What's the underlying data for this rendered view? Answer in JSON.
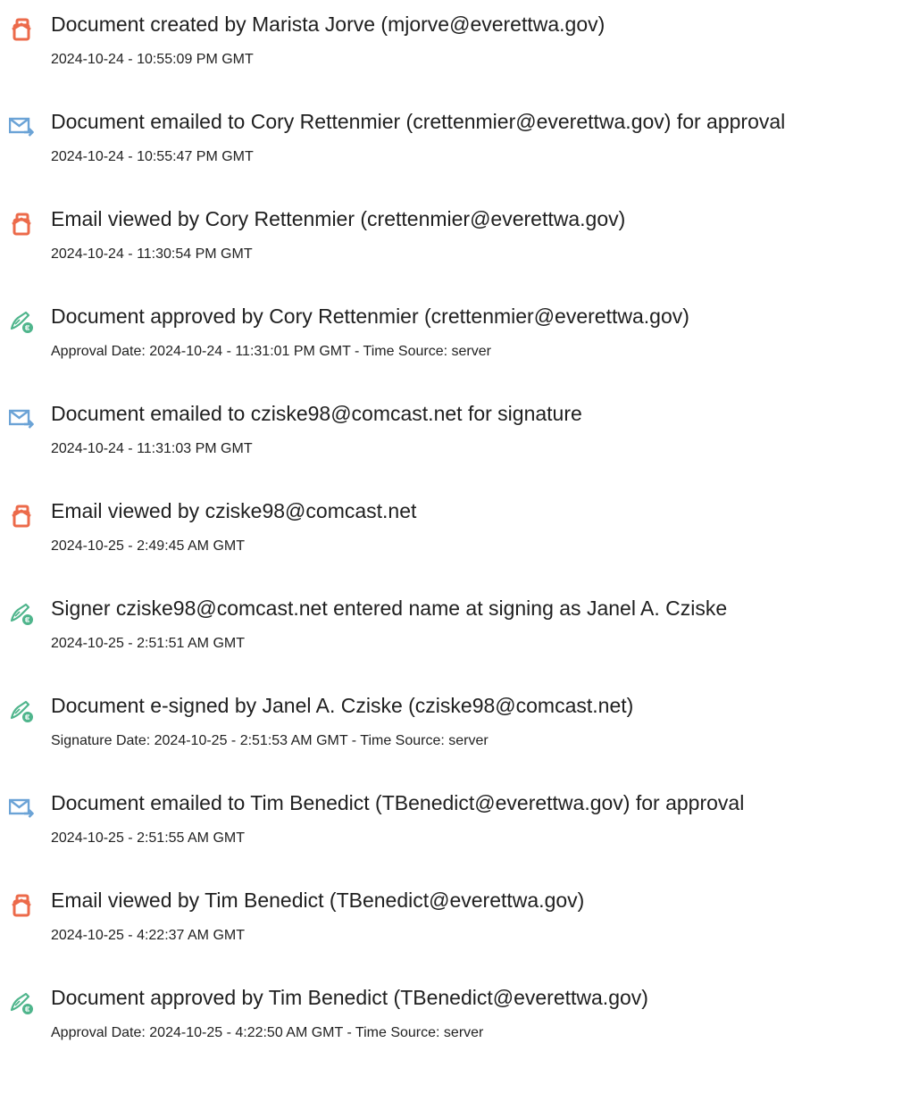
{
  "colors": {
    "icon_doc": "#ec6a4a",
    "icon_email": "#6ba3d6",
    "icon_sign": "#4fb58c"
  },
  "events": [
    {
      "icon": "document-created-icon",
      "title": "Document created by Marista Jorve (mjorve@everettwa.gov)",
      "time": "2024-10-24 - 10:55:09 PM GMT"
    },
    {
      "icon": "email-sent-icon",
      "title": "Document emailed to Cory Rettenmier (crettenmier@everettwa.gov) for approval",
      "time": "2024-10-24 - 10:55:47 PM GMT"
    },
    {
      "icon": "document-viewed-icon",
      "title": "Email viewed by Cory Rettenmier (crettenmier@everettwa.gov)",
      "time": "2024-10-24 - 11:30:54 PM GMT"
    },
    {
      "icon": "pen-signature-icon",
      "title": "Document approved by Cory Rettenmier (crettenmier@everettwa.gov)",
      "time": "Approval Date: 2024-10-24 - 11:31:01 PM GMT - Time Source: server"
    },
    {
      "icon": "email-sent-icon",
      "title": "Document emailed to cziske98@comcast.net for signature",
      "time": "2024-10-24 - 11:31:03 PM GMT"
    },
    {
      "icon": "document-viewed-icon",
      "title": "Email viewed by cziske98@comcast.net",
      "time": "2024-10-25 - 2:49:45 AM GMT"
    },
    {
      "icon": "pen-signature-icon",
      "title": "Signer cziske98@comcast.net entered name at signing as Janel A. Cziske",
      "time": "2024-10-25 - 2:51:51 AM GMT"
    },
    {
      "icon": "pen-signature-icon",
      "title": "Document e-signed by Janel A. Cziske (cziske98@comcast.net)",
      "time": "Signature Date: 2024-10-25 - 2:51:53 AM GMT - Time Source: server"
    },
    {
      "icon": "email-sent-icon",
      "title": "Document emailed to Tim Benedict (TBenedict@everettwa.gov) for approval",
      "time": "2024-10-25 - 2:51:55 AM GMT"
    },
    {
      "icon": "document-viewed-icon",
      "title": "Email viewed by Tim Benedict (TBenedict@everettwa.gov)",
      "time": "2024-10-25 - 4:22:37 AM GMT"
    },
    {
      "icon": "pen-signature-icon",
      "title": "Document approved by Tim Benedict (TBenedict@everettwa.gov)",
      "time": "Approval Date: 2024-10-25 - 4:22:50 AM GMT - Time Source: server"
    }
  ]
}
